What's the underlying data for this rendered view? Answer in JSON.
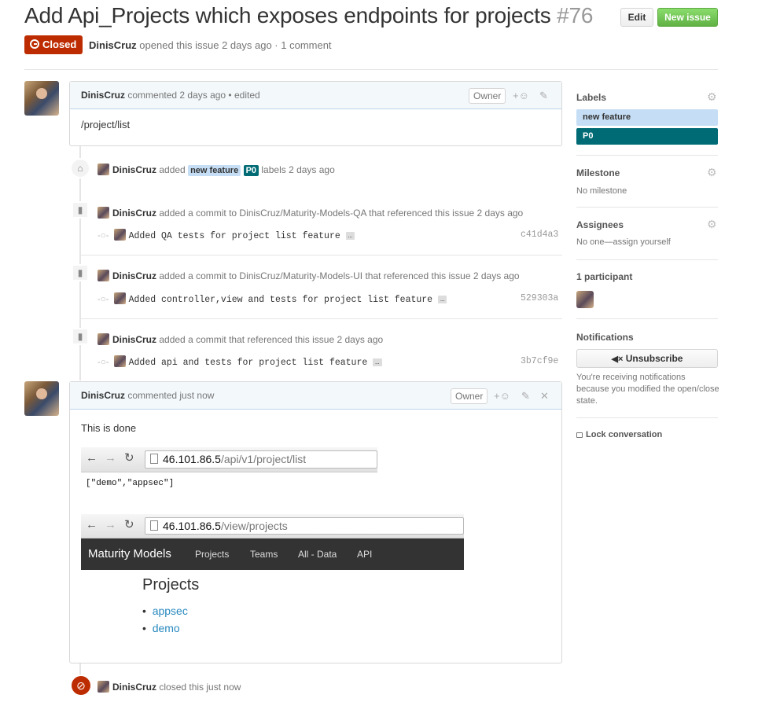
{
  "issue": {
    "title": "Add Api_Projects which exposes endpoints for projects",
    "number": "#76",
    "state": "Closed",
    "author": "DinisCruz",
    "meta_rest": "opened this issue 2 days ago · 1 comment",
    "edit_button": "Edit",
    "new_issue_button": "New issue"
  },
  "comment1": {
    "author": "DinisCruz",
    "meta": "commented 2 days ago • edited",
    "owner_badge": "Owner",
    "body": "/project/list"
  },
  "label_event": {
    "author": "DinisCruz",
    "action": "added",
    "labels": [
      "new feature",
      "P0"
    ],
    "rest": "labels 2 days ago"
  },
  "commit_events": [
    {
      "author": "DinisCruz",
      "text": "added a commit to DinisCruz/Maturity-Models-QA that referenced this issue 2 days ago",
      "message": "Added QA tests for project list feature",
      "sha": "c41d4a3"
    },
    {
      "author": "DinisCruz",
      "text": "added a commit to DinisCruz/Maturity-Models-UI that referenced this issue 2 days ago",
      "message": "Added controller,view and tests for project list feature",
      "sha": "529303a"
    },
    {
      "author": "DinisCruz",
      "text": "added a commit that referenced this issue 2 days ago",
      "message": "Added api and tests for project list feature",
      "sha": "3b7cf9e"
    }
  ],
  "ellipsis": "…",
  "comment2": {
    "author": "DinisCruz",
    "meta": "commented just now",
    "owner_badge": "Owner",
    "body": "This is done",
    "shot1": {
      "url_host": "46.101.86.5",
      "url_path": "/api/v1/project/list",
      "response": "[\"demo\",\"appsec\"]"
    },
    "shot2": {
      "url_host": "46.101.86.5",
      "url_path": "/view/projects",
      "brand": "Maturity Models",
      "nav": [
        "Projects",
        "Teams",
        "All - Data",
        "API"
      ],
      "heading": "Projects",
      "items": [
        "appsec",
        "demo"
      ]
    }
  },
  "close_event": {
    "author": "DinisCruz",
    "rest": "closed this just now"
  },
  "sidebar": {
    "labels_title": "Labels",
    "labels": [
      {
        "name": "new feature",
        "color": "#c5def5",
        "text_color": "#333333"
      },
      {
        "name": "P0",
        "color": "#006b75",
        "text_color": "#ffffff"
      }
    ],
    "milestone_title": "Milestone",
    "milestone_value": "No milestone",
    "assignees_title": "Assignees",
    "assignees_value": "No one—assign yourself",
    "participants_title": "1 participant",
    "notifications_title": "Notifications",
    "unsubscribe_button": "Unsubscribe",
    "notifications_text": [
      "You're receiving notifications",
      "because you modified the open/close",
      "state."
    ],
    "lock_link": "Lock conversation"
  },
  "colors": {
    "closed_red": "#bd2c00",
    "green_button": "#6cc644",
    "link_blue": "#4183c4",
    "navbar_dark": "#333333"
  }
}
